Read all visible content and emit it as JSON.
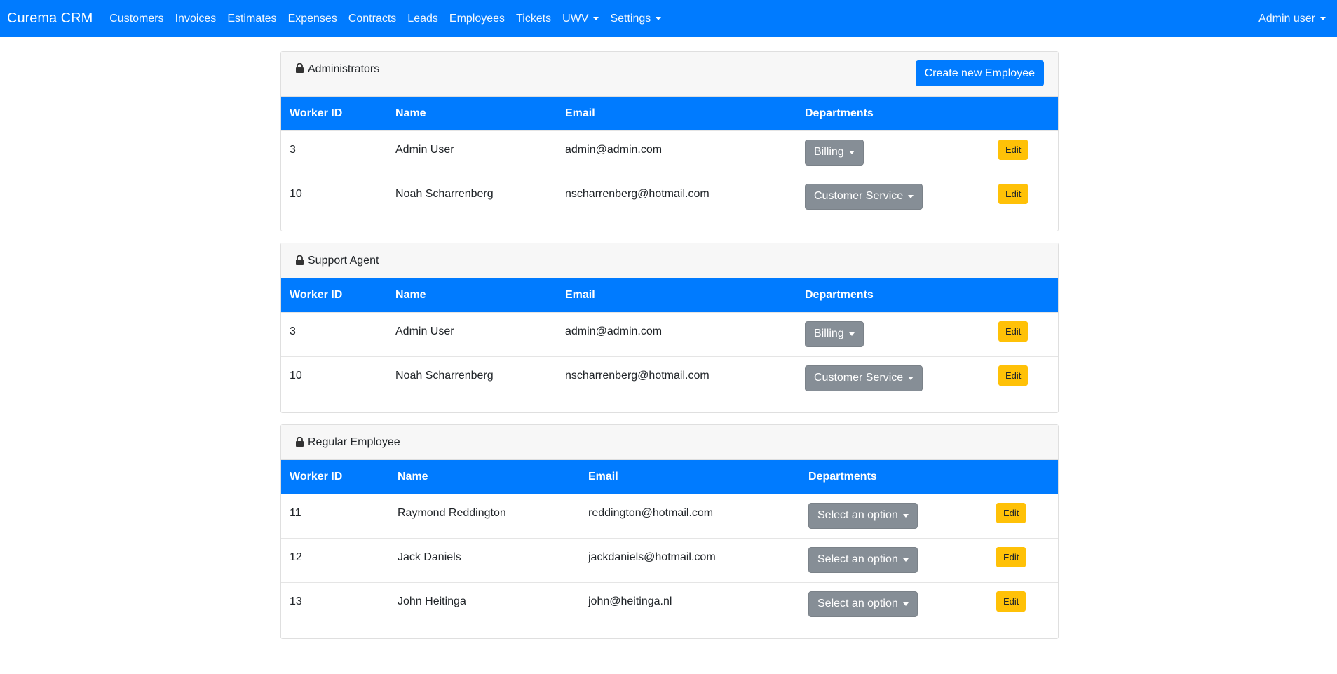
{
  "navbar": {
    "brand": "Curema CRM",
    "links": [
      "Customers",
      "Invoices",
      "Estimates",
      "Expenses",
      "Contracts",
      "Leads",
      "Employees",
      "Tickets"
    ],
    "dropdowns": [
      "UWV",
      "Settings"
    ],
    "user": "Admin user"
  },
  "colors": {
    "primary": "#007bff",
    "secondary": "#868e96",
    "warning": "#ffc107"
  },
  "create_button": "Create new Employee",
  "columns": [
    "Worker ID",
    "Name",
    "Email",
    "Departments"
  ],
  "edit_label": "Edit",
  "sections": [
    {
      "title": "Administrators",
      "rows": [
        {
          "id": "3",
          "name": "Admin User",
          "email": "admin@admin.com",
          "department": "Billing"
        },
        {
          "id": "10",
          "name": "Noah Scharrenberg",
          "email": "nscharrenberg@hotmail.com",
          "department": "Customer Service"
        }
      ]
    },
    {
      "title": "Support Agent",
      "rows": [
        {
          "id": "3",
          "name": "Admin User",
          "email": "admin@admin.com",
          "department": "Billing"
        },
        {
          "id": "10",
          "name": "Noah Scharrenberg",
          "email": "nscharrenberg@hotmail.com",
          "department": "Customer Service"
        }
      ]
    },
    {
      "title": "Regular Employee",
      "rows": [
        {
          "id": "11",
          "name": "Raymond Reddington",
          "email": "reddington@hotmail.com",
          "department": "Select an option"
        },
        {
          "id": "12",
          "name": "Jack Daniels",
          "email": "jackdaniels@hotmail.com",
          "department": "Select an option"
        },
        {
          "id": "13",
          "name": "John Heitinga",
          "email": "john@heitinga.nl",
          "department": "Select an option"
        }
      ]
    }
  ]
}
